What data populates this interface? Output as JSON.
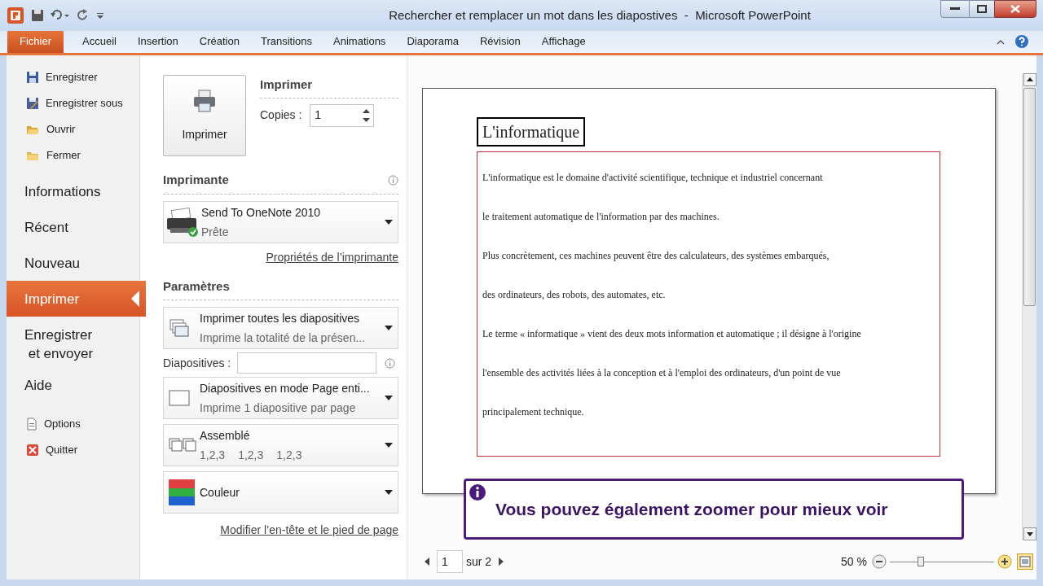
{
  "window": {
    "title": "Rechercher et remplacer un mot dans les diapostives  -  Microsoft PowerPoint"
  },
  "ribbon_tabs": [
    {
      "label": "Fichier",
      "selected": true
    },
    {
      "label": "Accueil",
      "selected": false
    },
    {
      "label": "Insertion",
      "selected": false
    },
    {
      "label": "Création",
      "selected": false
    },
    {
      "label": "Transitions",
      "selected": false
    },
    {
      "label": "Animations",
      "selected": false
    },
    {
      "label": "Diaporama",
      "selected": false
    },
    {
      "label": "Révision",
      "selected": false
    },
    {
      "label": "Affichage",
      "selected": false
    }
  ],
  "nav": [
    {
      "label": "Enregistrer",
      "kind": "save",
      "selected": false
    },
    {
      "label": "Enregistrer sous",
      "kind": "saveas",
      "selected": false
    },
    {
      "label": "Ouvrir",
      "kind": "open",
      "selected": false
    },
    {
      "label": "Fermer",
      "kind": "close",
      "selected": false
    },
    {
      "label": "Informations",
      "kind": "large",
      "selected": false
    },
    {
      "label": "Récent",
      "kind": "large",
      "selected": false
    },
    {
      "label": "Nouveau",
      "kind": "large",
      "selected": false
    },
    {
      "label": "Imprimer",
      "kind": "large",
      "selected": true
    },
    {
      "label": "Enregistrer\n et envoyer",
      "kind": "large",
      "selected": false
    },
    {
      "label": "Aide",
      "kind": "large",
      "selected": false
    },
    {
      "label": "Options",
      "kind": "options",
      "selected": false
    },
    {
      "label": "Quitter",
      "kind": "quit",
      "selected": false
    }
  ],
  "print": {
    "button": "Imprimer",
    "heading": "Imprimer",
    "copies_label": "Copies :",
    "copies": "1"
  },
  "printer": {
    "heading": "Imprimante",
    "name": "Send To OneNote 2010",
    "status": "Prête",
    "properties_link": "Propriétés de l’imprimante"
  },
  "settings": {
    "heading": "Paramètres",
    "items": [
      {
        "kind": "range",
        "title": "Imprimer toutes les diapositives",
        "subtitles": [
          "Imprime la totalité de la présen..."
        ]
      },
      {
        "kind": "field",
        "title": "Diapositives :"
      },
      {
        "kind": "layout",
        "title": "Diapositives en mode Page enti...",
        "subtitles": [
          "Imprime 1 diapositive par page"
        ]
      },
      {
        "kind": "collate",
        "title": "Assemblé",
        "subtitles": [
          "1,2,3",
          "1,2,3",
          "1,2,3"
        ]
      },
      {
        "kind": "color",
        "title": "Couleur"
      }
    ],
    "footer_link": "Modifier l’en-tête et le pied de page"
  },
  "preview": {
    "slide_title": "L'informatique",
    "lines": [
      "L'informatique  est le domaine d'activité scientifique, technique et industriel concernant",
      "le traitement automatique de l'information par des machines.",
      "Plus concrètement, ces machines peuvent être des calculateurs, des systèmes embarqués,",
      "des ordinateurs, des robots, des automates, etc.",
      "Le terme « informatique » vient des deux mots information et automatique ; il désigne à l'origine",
      "l'ensemble des activités liées à la conception et à l'emploi des ordinateurs, d'un point de vue",
      "principalement technique."
    ],
    "callout": "Vous pouvez également zoomer pour mieux voir",
    "page": "1",
    "page_total": "sur 2",
    "zoom": "50 %",
    "zoom_level": {
      "level": 0.3
    }
  }
}
